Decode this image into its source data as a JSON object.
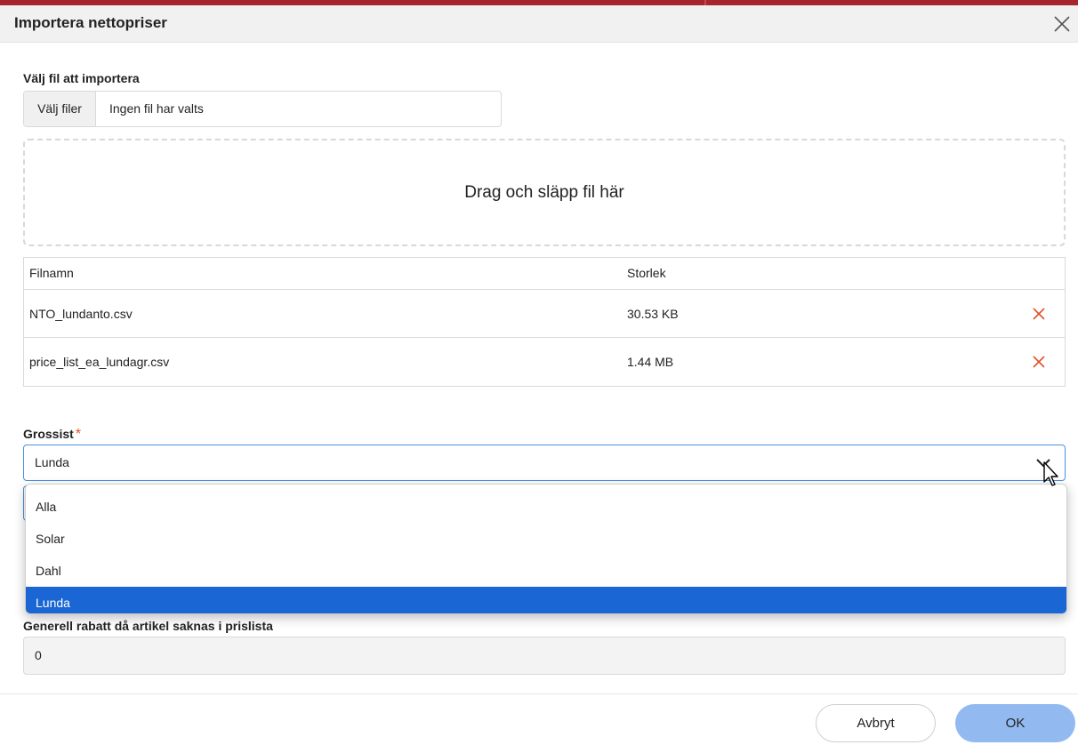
{
  "dialog": {
    "title": "Importera nettopriser"
  },
  "file_picker": {
    "label": "Välj fil att importera",
    "button_label": "Välj filer",
    "status": "Ingen fil har valts"
  },
  "dropzone": {
    "text": "Drag och släpp fil här"
  },
  "file_table": {
    "headers": {
      "name": "Filnamn",
      "size": "Storlek"
    },
    "rows": [
      {
        "name": "NTO_lundanto.csv",
        "size": "30.53 KB"
      },
      {
        "name": "price_list_ea_lundagr.csv",
        "size": "1.44 MB"
      }
    ]
  },
  "wholesaler": {
    "label": "Grossist",
    "required_mark": "*",
    "selected": "Lunda",
    "options": [
      "Alla",
      "Solar",
      "Dahl",
      "Lunda"
    ]
  },
  "discount": {
    "label": "Generell rabatt då artikel saknas i prislista",
    "value": "0"
  },
  "footer": {
    "cancel_label": "Avbryt",
    "ok_label": "OK"
  },
  "colors": {
    "brand_bar": "#a6262b",
    "focus_border": "#4a90e2",
    "selected_option": "#1a66d4",
    "primary_button": "#93b9f1",
    "delete_icon": "#e0522a"
  }
}
